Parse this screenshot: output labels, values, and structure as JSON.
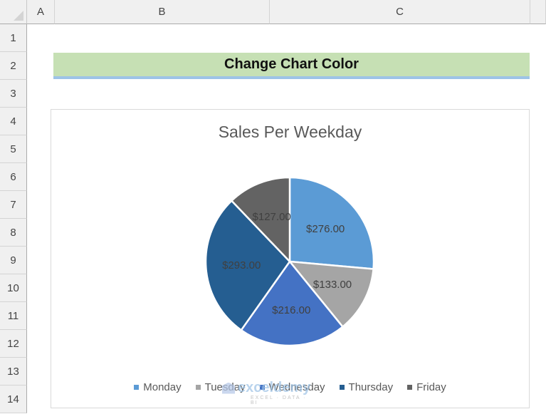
{
  "sheet": {
    "columns": [
      "A",
      "B",
      "C"
    ],
    "rows": [
      "1",
      "2",
      "3",
      "4",
      "5",
      "6",
      "7",
      "8",
      "9",
      "10",
      "11",
      "12",
      "13",
      "14"
    ],
    "title_cell": "Change Chart Color"
  },
  "watermark": {
    "brand": "exceldemy",
    "sub": "EXCEL · DATA · BI"
  },
  "chart_data": {
    "type": "pie",
    "title": "Sales Per Weekday",
    "categories": [
      "Monday",
      "Tuesday",
      "Wednesday",
      "Thursday",
      "Friday"
    ],
    "values": [
      276,
      133,
      216,
      293,
      127
    ],
    "data_labels": [
      "$276.00",
      "$133.00",
      "$216.00",
      "$293.00",
      "$127.00"
    ],
    "colors": [
      "#5b9bd5",
      "#a5a5a5",
      "#4472c4",
      "#255e91",
      "#636363"
    ],
    "start_angle": "12 o'clock",
    "direction": "clockwise",
    "legend_position": "bottom"
  }
}
